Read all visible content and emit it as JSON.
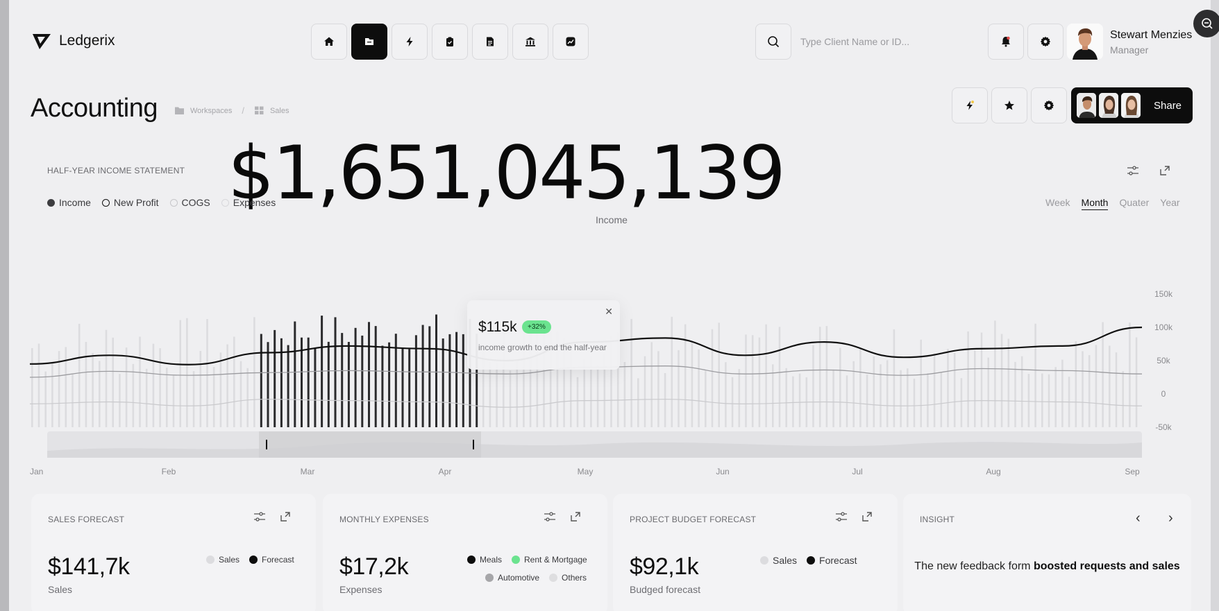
{
  "app": {
    "name": "Ledgerix"
  },
  "nav": {
    "items": [
      {
        "icon": "home-icon",
        "active": false
      },
      {
        "icon": "folder-icon",
        "active": true
      },
      {
        "icon": "bolt-icon",
        "active": false
      },
      {
        "icon": "clipboard-icon",
        "active": false
      },
      {
        "icon": "document-icon",
        "active": false
      },
      {
        "icon": "bank-icon",
        "active": false
      },
      {
        "icon": "trend-icon",
        "active": false
      }
    ]
  },
  "search": {
    "placeholder": "Type Client Name or ID..."
  },
  "user": {
    "name": "Stewart Menzies",
    "role": "Manager"
  },
  "page": {
    "title": "Accounting",
    "breadcrumb": [
      "Workspaces",
      "Sales"
    ],
    "share_label": "Share"
  },
  "headline": {
    "value": "$1,651,045,139",
    "caption": "Income"
  },
  "statement": {
    "label": "HALF-YEAR INCOME STATEMENT",
    "legend": [
      "Income",
      "New Profit",
      "COGS",
      "Expenses"
    ],
    "periods": [
      "Week",
      "Month",
      "Quater",
      "Year"
    ],
    "active_period": "Month"
  },
  "tooltip": {
    "value": "$115k",
    "badge": "+32%",
    "text": "income growth to end the half-year"
  },
  "chart_data": {
    "type": "bar",
    "x_labels": [
      "Jan",
      "Feb",
      "Mar",
      "Apr",
      "May",
      "Jun",
      "Jul",
      "Aug",
      "Sep"
    ],
    "y_ticks": [
      "150k",
      "100k",
      "50k",
      "0",
      "-50k"
    ],
    "ylim": [
      -50,
      150
    ],
    "highlight_range": [
      "Feb",
      "Apr"
    ],
    "series": [
      {
        "name": "Income",
        "type": "line",
        "values": [
          45,
          58,
          44,
          62,
          72,
          68,
          50,
          78,
          84,
          58,
          78,
          55,
          68,
          72,
          100
        ]
      },
      {
        "name": "New Profit",
        "type": "line",
        "values": [
          25,
          34,
          28,
          32,
          35,
          33,
          30,
          40,
          42,
          30,
          36,
          28,
          38,
          35,
          30
        ]
      },
      {
        "name": "Expenses",
        "type": "line",
        "values": [
          -15,
          -12,
          -18,
          -8,
          -10,
          -12,
          -20,
          -10,
          -8,
          -15,
          -12,
          -18,
          -10,
          -12,
          -18
        ]
      }
    ]
  },
  "cards": {
    "sales": {
      "label": "SALES FORECAST",
      "value": "$141,7k",
      "sub": "Sales",
      "legend": [
        "Sales",
        "Forecast"
      ]
    },
    "expenses": {
      "label": "MONTHLY EXPENSES",
      "value": "$17,2k",
      "sub": "Expenses",
      "legend": [
        "Meals",
        "Rent & Mortgage",
        "Automotive",
        "Others"
      ]
    },
    "budget": {
      "label": "PROJECT BUDGET FORECAST",
      "value": "$92,1k",
      "sub": "Budged forecast",
      "legend": [
        "Sales",
        "Forecast"
      ]
    },
    "insight": {
      "label": "INSIGHT",
      "text_plain": "The new feedback form",
      "text_bold": "boosted requests and sales"
    }
  },
  "colors": {
    "accent": "#0d0d0d",
    "badge_green": "#6be38f",
    "background": "#efeff1"
  }
}
